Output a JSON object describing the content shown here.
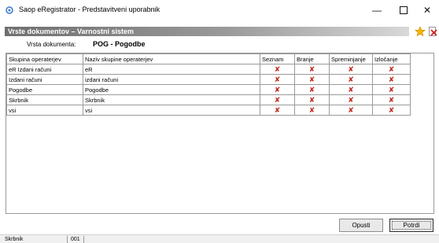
{
  "window": {
    "title": "Saop eRegistrator - Predstavitveni uporabnik",
    "minimize_glyph": "—",
    "close_glyph": "✕"
  },
  "section": {
    "title": "Vrste dokumentov – Varnostni sistem"
  },
  "document_type": {
    "label": "Vrsta dokumenta:",
    "value": "POG - Pogodbe"
  },
  "table": {
    "columns": [
      "Skupina operaterjev",
      "Naziv skupine operaterjev",
      "Seznam",
      "Branje",
      "Spreminjanje",
      "Izločanje"
    ],
    "rows": [
      [
        "eR Izdani računi",
        "eR",
        "✘",
        "✘",
        "✘",
        "✘"
      ],
      [
        "Izdani računi",
        "izdani računi",
        "✘",
        "✘",
        "✘",
        "✘"
      ],
      [
        "Pogodbe",
        "Pogodbe",
        "✘",
        "✘",
        "✘",
        "✘"
      ],
      [
        "Skrbnik",
        "Skrbnik",
        "✘",
        "✘",
        "✘",
        "✘"
      ],
      [
        "vsi",
        "vsi",
        "✘",
        "✘",
        "✘",
        "✘"
      ]
    ]
  },
  "buttons": {
    "cancel": "Opusti",
    "ok": "Potrdi"
  },
  "status": {
    "user": "Skrbnik",
    "code": "001"
  },
  "colors": {
    "denied_mark": "#c0281e",
    "header_dark": "#6f6f6f",
    "star": "#f5b400"
  },
  "icons": {
    "app": "eregistrator-app-icon",
    "favorite": "star-icon",
    "delete": "delete-document-icon"
  }
}
